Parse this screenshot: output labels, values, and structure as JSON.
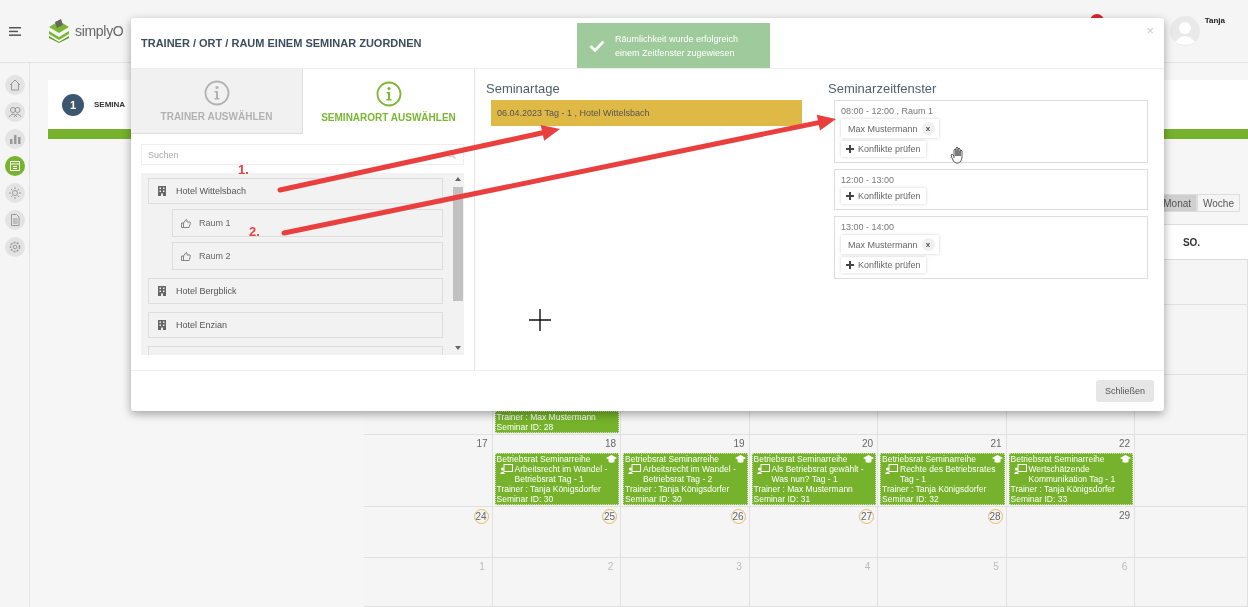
{
  "header": {
    "logo_text": "simplyO",
    "user_name": "Tanja",
    "notification": true
  },
  "sidebar": {
    "items": [
      {
        "kind": "home",
        "selected": false
      },
      {
        "kind": "people",
        "selected": false
      },
      {
        "kind": "chart",
        "selected": false
      },
      {
        "kind": "calendar",
        "selected": true
      },
      {
        "kind": "sun",
        "selected": false
      },
      {
        "kind": "document",
        "selected": false
      },
      {
        "kind": "gear",
        "selected": false
      }
    ]
  },
  "wizard": {
    "step_number": "1",
    "step_label": "SEMINA",
    "level": 1
  },
  "calendar": {
    "view_buttons": [
      {
        "label": "Monat",
        "selected": true
      },
      {
        "label": "Woche",
        "selected": false
      }
    ],
    "weekday": "SO.",
    "partial_event": {
      "trainer": "Trainer : Max Mustermann",
      "seminar_id": "Seminar ID: 28"
    },
    "weeks": [
      {
        "days": [
          {
            "number": "17",
            "circled": false,
            "other_month": false
          },
          {
            "number": "18",
            "circled": false,
            "other_month": false,
            "event": {
              "series": "Betriebsrat Seminarreihe",
              "title": "Arbeitsrecht im Wandel - Betriebsrat Tag - 1",
              "trainer": "Trainer : Tanja Königsdorfer",
              "seminar_id": "Seminar ID: 30"
            }
          },
          {
            "number": "19",
            "circled": false,
            "other_month": false,
            "event": {
              "series": "Betriebsrat Seminarreihe",
              "title": "Arbeitsrecht im Wandel - Betriebsrat Tag - 2",
              "trainer": "Trainer : Tanja Königsdorfer",
              "seminar_id": "Seminar ID: 30"
            }
          },
          {
            "number": "20",
            "circled": false,
            "other_month": false,
            "event": {
              "series": "Betriebsrat Seminarreihe",
              "title": "Als Betriebsrat gewählt - Was nun? Tag - 1",
              "trainer": "Trainer : Max Mustermann",
              "seminar_id": "Seminar ID: 31"
            }
          },
          {
            "number": "21",
            "circled": false,
            "other_month": false,
            "event": {
              "series": "Betriebsrat Seminarreihe",
              "title": "Rechte des Betriebsrates Tag - 1",
              "trainer": "Trainer : Tanja Königsdorfer",
              "seminar_id": "Seminar ID: 32"
            }
          },
          {
            "number": "22",
            "circled": false,
            "other_month": false,
            "event": {
              "series": "Betriebsrat Seminarreihe",
              "title": "Wertschätzende Kommunikation Tag - 1",
              "trainer": "Trainer : Tanja Königsdorfer",
              "seminar_id": "Seminar ID: 33"
            }
          }
        ]
      },
      {
        "days": [
          {
            "number": "24",
            "circled": true,
            "other_month": false
          },
          {
            "number": "25",
            "circled": true,
            "other_month": false
          },
          {
            "number": "26",
            "circled": true,
            "other_month": false
          },
          {
            "number": "27",
            "circled": true,
            "other_month": false
          },
          {
            "number": "28",
            "circled": true,
            "other_month": false
          },
          {
            "number": "29",
            "circled": false,
            "other_month": false
          }
        ]
      },
      {
        "days": [
          {
            "number": "1",
            "circled": false,
            "other_month": true
          },
          {
            "number": "2",
            "circled": false,
            "other_month": true
          },
          {
            "number": "3",
            "circled": false,
            "other_month": true
          },
          {
            "number": "4",
            "circled": false,
            "other_month": true
          },
          {
            "number": "5",
            "circled": false,
            "other_month": true
          },
          {
            "number": "6",
            "circled": false,
            "other_month": true
          }
        ]
      }
    ]
  },
  "dialog": {
    "title": "TRAINER / ORT / RAUM EINEM SEMINAR ZUORDNEN",
    "close_label": "×",
    "toast": "Räumlichkeit wurde erfolgreich einem Zeitfenster zugewiesen",
    "tabs": [
      {
        "label": "TRAINER AUSWÄHLEN",
        "selected": false
      },
      {
        "label": "SEMINARORT AUSWÄHLEN",
        "selected": true
      }
    ],
    "search": {
      "placeholder": "Suchen"
    },
    "locations": [
      {
        "name": "Hotel Wittelsbach",
        "children": [
          {
            "name": "Raum 1"
          },
          {
            "name": "Raum 2"
          }
        ]
      },
      {
        "name": "Hotel Bergblick"
      },
      {
        "name": "Hotel Enzian"
      }
    ],
    "days_heading": "Seminartage",
    "days": [
      {
        "label": "06.04.2023 Tag - 1 , Hotel Wittelsbach",
        "selected": true
      }
    ],
    "slots_heading": "Seminarzeitfenster",
    "slots": [
      {
        "time": "08:00 - 12:00 , Raum 1",
        "trainers": [
          {
            "name": "Max Mustermann",
            "remove": "x"
          }
        ],
        "action": "Konflikte prüfen"
      },
      {
        "time": "12:00 - 13:00",
        "action": "Konflikte prüfen"
      },
      {
        "time": "13:00 - 14:00",
        "trainers": [
          {
            "name": "Max Mustermann",
            "remove": "x"
          }
        ],
        "action": "Konflikte prüfen"
      }
    ],
    "close_button": "Schließen"
  },
  "annotations": [
    {
      "label": "1."
    },
    {
      "label": "2."
    }
  ]
}
